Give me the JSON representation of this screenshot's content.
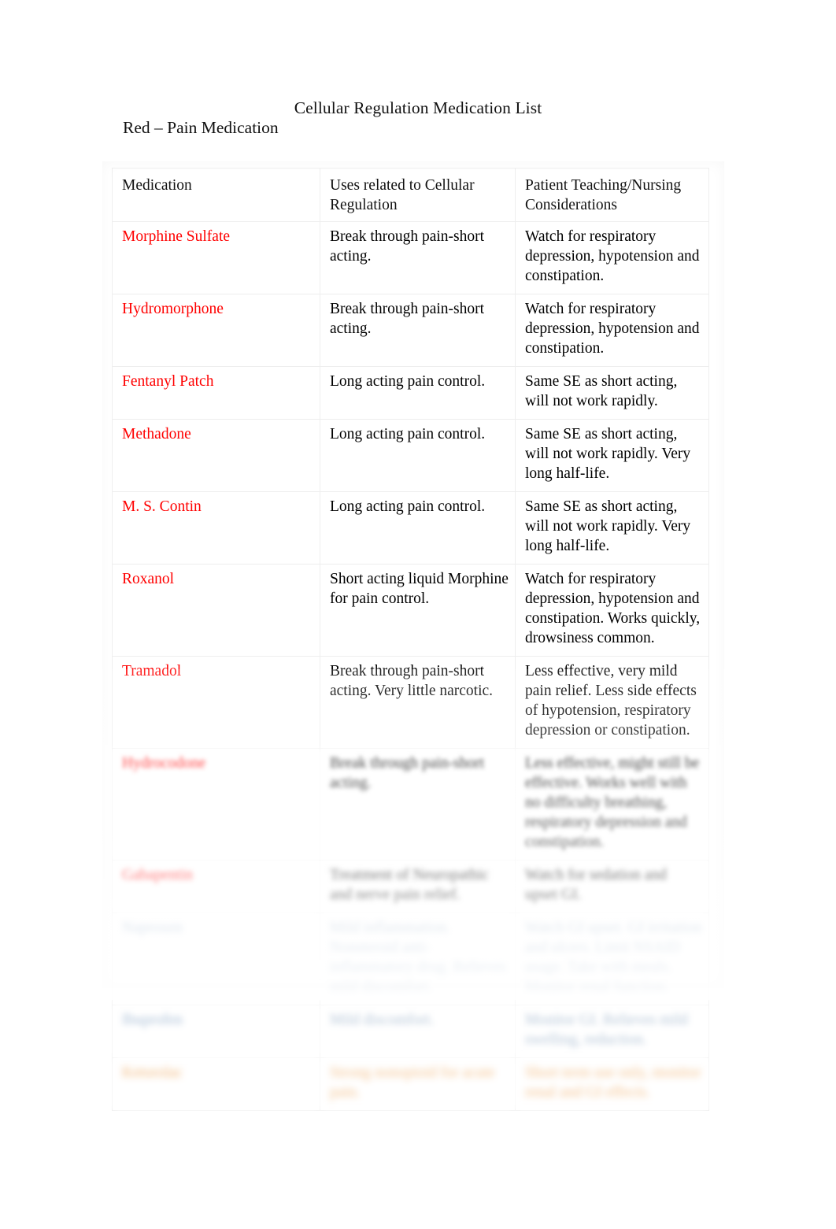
{
  "document": {
    "title": "Cellular Regulation Medication List",
    "subtitle": "Red – Pain Medication"
  },
  "colors": {
    "pain_red": "#FF0000",
    "blue_group": "#A6BCD4",
    "orange_group": "#F0B476",
    "body_text": "#000000",
    "page_background": "#FFFFFF"
  },
  "table": {
    "headers": {
      "medication": "Medication",
      "uses": "Uses related to Cellular Regulation",
      "teaching": "Patient Teaching/Nursing Considerations"
    },
    "rows": [
      {
        "medication": "Morphine Sulfate",
        "uses": "Break through pain-short acting.",
        "teaching": "Watch for respiratory depression, hypotension and constipation.",
        "color_group": "red",
        "blur": 0
      },
      {
        "medication": "Hydromorphone",
        "uses": "Break through pain-short acting.",
        "teaching": "Watch for respiratory depression, hypotension and constipation.",
        "color_group": "red",
        "blur": 0
      },
      {
        "medication": "Fentanyl Patch",
        "uses": "Long acting pain control.",
        "teaching": "Same SE as short acting, will not work rapidly.",
        "color_group": "red",
        "blur": 0
      },
      {
        "medication": "Methadone",
        "uses": "Long acting pain control.",
        "teaching": "Same SE as short acting, will not work rapidly. Very long half-life.",
        "color_group": "red",
        "blur": 0
      },
      {
        "medication": "M. S. Contin",
        "uses": "Long acting pain control.",
        "teaching": "Same SE as short acting, will not work rapidly. Very long half-life.",
        "color_group": "red",
        "blur": 0
      },
      {
        "medication": "Roxanol",
        "uses": "Short acting liquid Morphine for pain control.",
        "teaching": "Watch for respiratory depression, hypotension and constipation. Works quickly, drowsiness common.",
        "color_group": "red",
        "blur": 0
      },
      {
        "medication": "Tramadol",
        "uses": "Break through pain-short acting. Very little narcotic.",
        "teaching": "Less effective, very mild pain relief. Less side effects of hypotension, respiratory depression or constipation.",
        "color_group": "red",
        "blur": 0
      },
      {
        "medication": "Hydrocodone",
        "uses": "Break through pain-short acting.",
        "teaching": "Less effective, might still be effective. Works well with no difficulty breathing, respiratory depression and constipation.",
        "color_group": "red",
        "blur": 1
      },
      {
        "medication": "Gabapentin",
        "uses": "Treatment of Neuropathic and nerve pain relief.",
        "teaching": "Watch for sedation and upset GI.",
        "color_group": "red",
        "blur": 2
      },
      {
        "medication": "Naproxen",
        "uses": "Mild inflammation. Nonsteroid anti-inflammatory drug. Relieves mild discomfort.",
        "teaching": "Watch GI upset. GI irritation and ulcers. Limit NSAID usage. Take with meals. Monitor renal function.",
        "color_group": "blue",
        "blur": 3
      },
      {
        "medication": "Ibuprofen",
        "uses": "Mild discomfort.",
        "teaching": "Monitor GI. Relieves mild swelling, reduction.",
        "color_group": "blue",
        "blur": 4
      },
      {
        "medication": "Ketorolac",
        "uses": "Strong nonopioid for acute pain.",
        "teaching": "Short term use only, monitor renal and GI effects.",
        "color_group": "orange",
        "blur": 5
      }
    ]
  }
}
